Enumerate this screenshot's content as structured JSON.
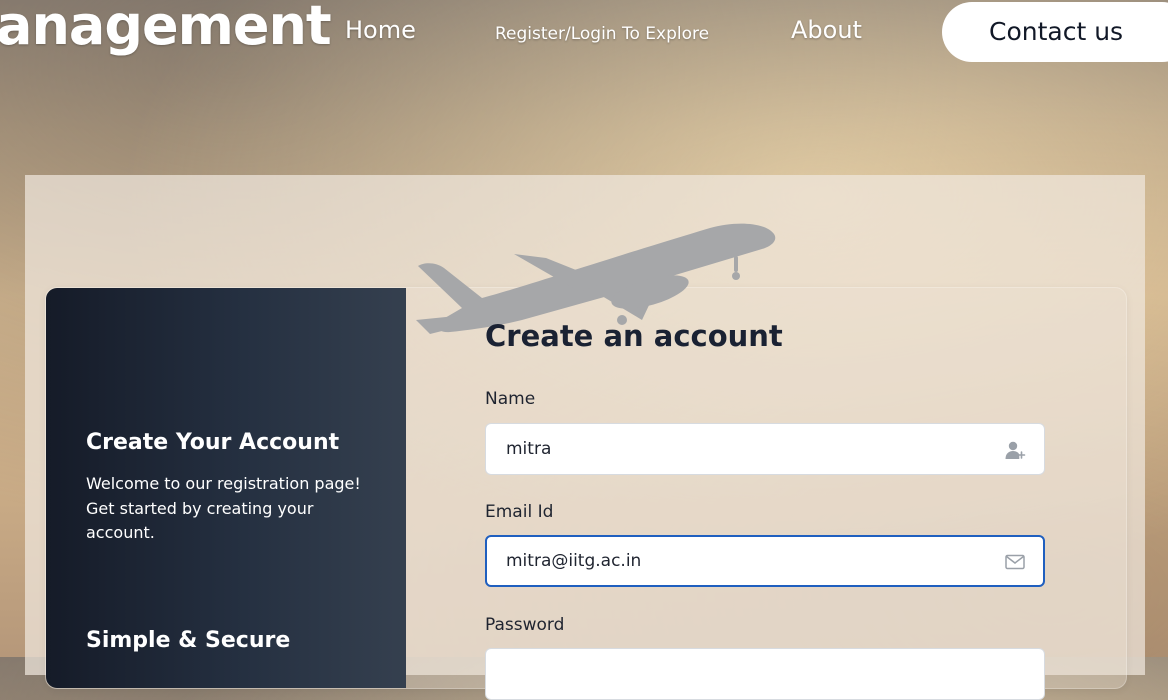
{
  "nav": {
    "brand": "anagement",
    "home": "Home",
    "register": "Register/Login To Explore",
    "about": "About",
    "contact": "Contact us"
  },
  "sidebar": {
    "title": "Create Your Account",
    "text": "Welcome to our registration page! Get started by creating your account.",
    "title2": "Simple & Secure"
  },
  "form": {
    "title": "Create an account",
    "name_label": "Name",
    "name_value": "mitra",
    "name_icon": "add-user-icon",
    "email_label": "Email Id",
    "email_value": "mitra@iitg.ac.in",
    "email_icon": "mail-icon",
    "password_label": "Password"
  },
  "colors": {
    "accent": "#1f5fbf",
    "sidebar_dark": "#151b28",
    "heading": "#1a2233"
  }
}
